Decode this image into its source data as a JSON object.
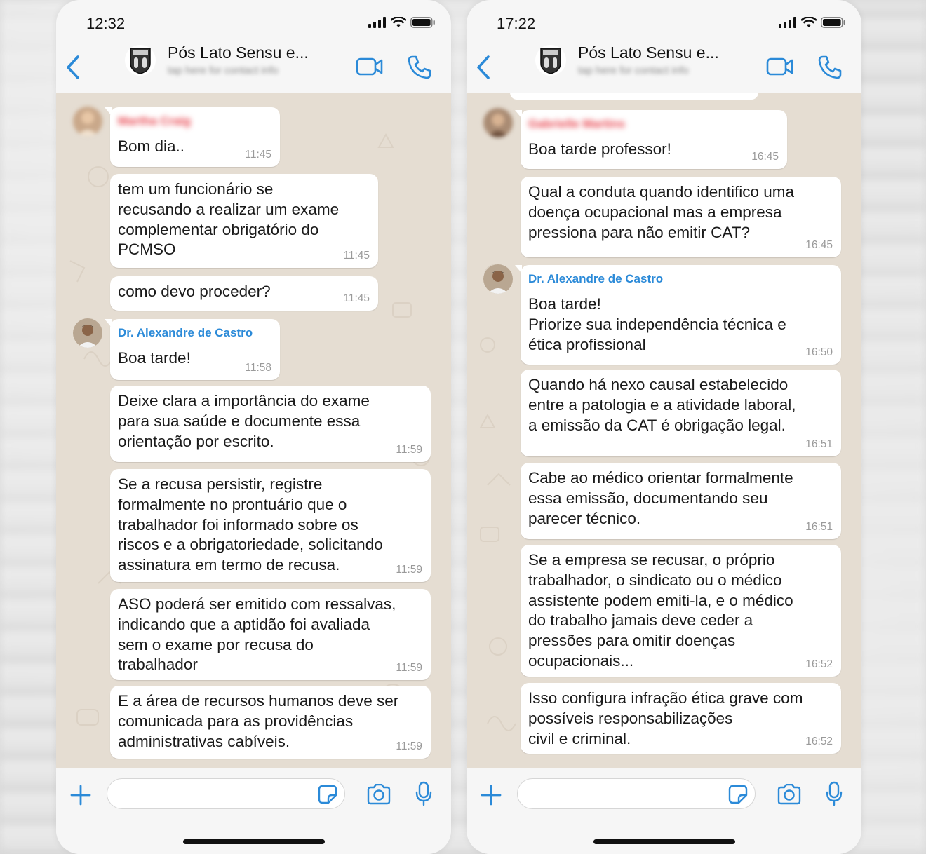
{
  "left": {
    "time": "12:32",
    "header": {
      "name": "Pós Lato Sensu e...",
      "subtitle": "tap here for contact info"
    },
    "messages": [
      {
        "sender": "Martha Craig",
        "text": "Bom dia..",
        "time": "11:45"
      },
      {
        "text": "tem um funcionário se\nrecusando a realizar um exame\ncomplementar obrigatório do\nPCMSO",
        "time": "11:45"
      },
      {
        "text": "como devo proceder?",
        "time": "11:45"
      },
      {
        "sender": "Dr. Alexandre de Castro",
        "text": "Boa tarde!",
        "time": "11:58"
      },
      {
        "text": "Deixe clara a importância do exame\npara sua saúde e documente essa\norientação por escrito.",
        "time": "11:59"
      },
      {
        "text": "Se a recusa persistir, registre\nformalmente no prontuário que o\ntrabalhador foi informado sobre os\nriscos e a obrigatoriedade, solicitando\nassinatura em termo de recusa.",
        "time": "11:59"
      },
      {
        "text": "ASO poderá ser emitido com ressalvas,\nindicando que a aptidão foi avaliada\nsem o exame por recusa do\ntrabalhador",
        "time": "11:59"
      },
      {
        "text": "E a área de recursos humanos deve ser\ncomunicada para as providências\nadministrativas cabíveis.",
        "time": "11:59"
      }
    ]
  },
  "right": {
    "time": "17:22",
    "header": {
      "name": "Pós Lato Sensu e...",
      "subtitle": "tap here for contact info"
    },
    "messages": [
      {
        "sender": "Gabrielle Martins",
        "text": "Boa tarde professor!",
        "time": "16:45"
      },
      {
        "text": "Qual a conduta quando identifico uma\ndoença ocupacional mas a empresa\npressiona para não emitir CAT?",
        "time": "16:45"
      },
      {
        "sender": "Dr. Alexandre de Castro",
        "text": "Boa tarde!\nPriorize sua independência técnica e\nética profissional",
        "time": "16:50"
      },
      {
        "text": "Quando há nexo causal estabelecido\nentre a patologia e a atividade laboral,\na emissão da CAT é obrigação legal.",
        "time": "16:51"
      },
      {
        "text": "Cabe ao médico orientar formalmente\nessa emissão, documentando seu\nparecer técnico.",
        "time": "16:51"
      },
      {
        "text": "Se a empresa se recusar, o próprio\ntrabalhador, o sindicato ou o médico\nassistente podem emiti-la, e o médico\ndo trabalho jamais deve ceder a\npressões para omitir doenças\nocupacionais...",
        "time": "16:52"
      },
      {
        "text": "Isso configura infração ética grave com\npossíveis responsabilizações\ncivil e criminal.",
        "time": "16:52"
      }
    ]
  },
  "icons": {
    "back": "chevron-left-icon",
    "video": "video-camera-icon",
    "call": "phone-icon",
    "plus": "plus-icon",
    "sticker": "sticker-icon",
    "camera": "camera-icon",
    "mic": "microphone-icon"
  },
  "colors": {
    "accent": "#2b8ad8",
    "chat_bg": "#e5ddd2",
    "sender_name": "#2b8ad8",
    "blurred_name": "#e8434d"
  }
}
